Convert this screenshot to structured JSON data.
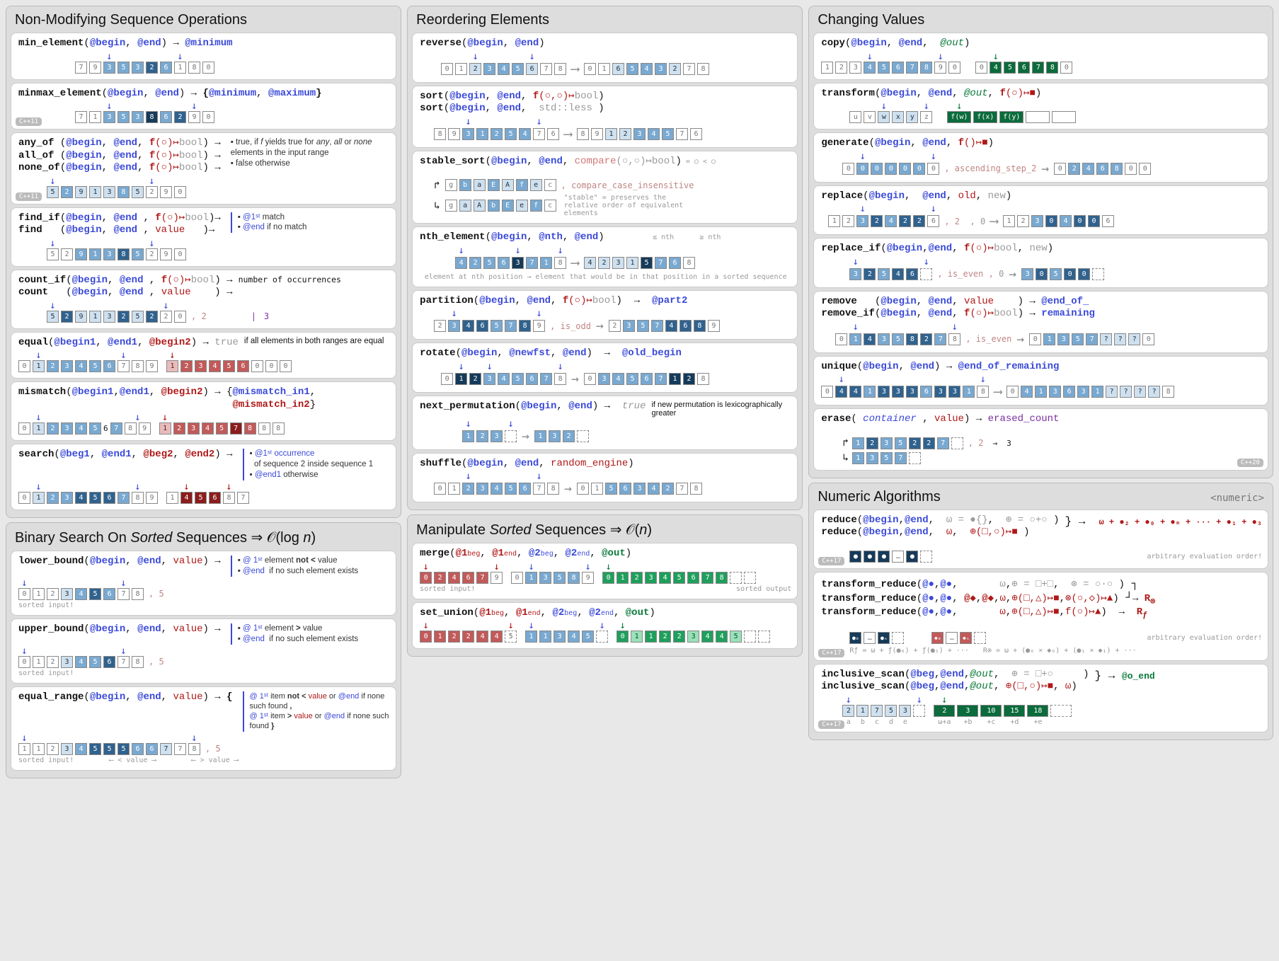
{
  "sections": {
    "nonmod": {
      "title": "Non-Modifying Sequence Operations"
    },
    "binsearch": {
      "title_html": "Binary Search On <i>Sorted</i> Sequences ⇒ 𝒪(log n)"
    },
    "reorder": {
      "title": "Reordering Elements"
    },
    "manip": {
      "title_html": "Manipulate <i>Sorted</i> Sequences ⇒ 𝒪(n)"
    },
    "change": {
      "title": "Changing Values"
    },
    "numeric": {
      "title": "Numeric Algorithms",
      "meta": "<numeric>"
    }
  },
  "min_element": {
    "fn": "min_element",
    "p1": "@begin",
    "p2": "@end",
    "ret": "@minimum",
    "cells": [
      7,
      9,
      3,
      5,
      3,
      2,
      6,
      1,
      8,
      0
    ]
  },
  "minmax_element": {
    "fn": "minmax_element",
    "p1": "@begin",
    "p2": "@end",
    "ret": "{@minimum, @maximum}",
    "cells": [
      7,
      1,
      3,
      5,
      3,
      8,
      6,
      2,
      9,
      0
    ],
    "tag": "C++11"
  },
  "any_all_none": {
    "f1": "any_of",
    "f2": "all_of",
    "f3": "none_of",
    "p1": "@begin",
    "p2": "@end",
    "pred": "f(○)↦bool",
    "n1": "true, if <i>f</i> yields true for <i>any</i>, <i>all</i> or <i>none</i> elements in the input range",
    "n2": "false otherwise",
    "cells": [
      5,
      2,
      9,
      1,
      3,
      8,
      5,
      2,
      9,
      0
    ],
    "tag": "C++11"
  },
  "find": {
    "f1": "find_if",
    "f2": "find",
    "p1": "@begin",
    "p2": "@end",
    "pred": "f(○)↦bool",
    "val": "value",
    "n1": "@1ˢᵗ match",
    "n2": "@end if no match",
    "cells": [
      5,
      2,
      9,
      1,
      3,
      8,
      5,
      2,
      9,
      0
    ],
    "value_ex": "8"
  },
  "count": {
    "f1": "count_if",
    "f2": "count",
    "p1": "@begin",
    "p2": "@end",
    "pred": "f(○)↦bool",
    "val": "value",
    "ret": "number of occurrences",
    "cells": [
      5,
      2,
      9,
      1,
      3,
      2,
      5,
      2,
      2,
      0
    ],
    "value_ex": "2",
    "out": "3"
  },
  "equal": {
    "fn": "equal",
    "p1": "@begin1",
    "p2": "@end1",
    "p3": "@begin2",
    "ret": "true",
    "note": "if all elements in both ranges are equal",
    "a": [
      0,
      1,
      2,
      3,
      4,
      5,
      6,
      7,
      8,
      9
    ],
    "b": [
      1,
      2,
      3,
      4,
      5,
      6,
      0,
      0,
      0
    ]
  },
  "mismatch": {
    "fn": "mismatch",
    "p1": "@begin1",
    "p2": "@end1",
    "p3": "@begin2",
    "ret": "{@mismatch_in1, @mismatch_in2}",
    "a": [
      0,
      1,
      2,
      3,
      4,
      5,
      6,
      7,
      8,
      9
    ],
    "b": [
      1,
      2,
      3,
      4,
      5,
      7,
      8,
      8,
      8
    ]
  },
  "search": {
    "fn": "search",
    "p1": "@beg1",
    "p2": "@end1",
    "p3": "@beg2",
    "p4": "@end2",
    "n1": "@1ˢᵗ occurrence",
    "n1b": "of sequence 2 inside sequence 1",
    "n2": "@end1 otherwise",
    "a": [
      0,
      1,
      2,
      3,
      4,
      5,
      6,
      7,
      8,
      9
    ],
    "b": [
      1,
      4,
      5,
      6,
      8,
      7
    ]
  },
  "lower_bound": {
    "fn": "lower_bound",
    "p1": "@begin",
    "p2": "@end",
    "val": "value",
    "n1": "@ 1ˢᵗ element <b>not &lt;</b> value",
    "n2": "@end  if no such element exists",
    "cells": [
      0,
      1,
      2,
      3,
      4,
      5,
      6,
      7,
      8
    ],
    "value_ex": "5",
    "sorted": "sorted input!"
  },
  "upper_bound": {
    "fn": "upper_bound",
    "p1": "@begin",
    "p2": "@end",
    "val": "value",
    "n1": "@ 1ˢᵗ element <b>&gt;</b> value",
    "n2": "@end  if no such element exists",
    "cells": [
      0,
      1,
      2,
      3,
      4,
      5,
      6,
      7,
      8
    ],
    "value_ex": "5",
    "sorted": "sorted input!"
  },
  "equal_range": {
    "fn": "equal_range",
    "p1": "@begin",
    "p2": "@end",
    "val": "value",
    "n1": "@ 1ˢᵗ item <b>not &lt;</b> value or @end if none such found <b>,</b>",
    "n2": "@ 1ˢᵗ item <b>&gt;</b> value or @end if none such found <b>}</b>",
    "cells": [
      1,
      1,
      2,
      3,
      4,
      5,
      5,
      5,
      6,
      6,
      7,
      7,
      8
    ],
    "value_ex": "5",
    "sorted": "sorted input!",
    "lt": "< value",
    "gt": "> value"
  },
  "reverse": {
    "fn": "reverse",
    "p1": "@begin",
    "p2": "@end",
    "a": [
      0,
      1,
      2,
      3,
      4,
      5,
      6,
      7,
      8
    ],
    "b": [
      0,
      1,
      6,
      5,
      4,
      3,
      2,
      7,
      8
    ]
  },
  "sort": {
    "fn": "sort",
    "p1": "@begin",
    "p2": "@end",
    "pred": "f(○,○)↦bool",
    "alt": "std::less",
    "a": [
      8,
      9,
      3,
      1,
      2,
      5,
      4,
      7,
      6
    ],
    "b": [
      8,
      9,
      1,
      2,
      3,
      4,
      5,
      7,
      6
    ]
  },
  "stable_sort": {
    "fn": "stable_sort",
    "p1": "@begin",
    "p2": "@end",
    "pred": "compare(○,○)↦bool",
    "a": [
      "g",
      "b",
      "a",
      "E",
      "A",
      "f",
      "e",
      "c"
    ],
    "b": [
      "g",
      "a",
      "A",
      "b",
      "E",
      "e",
      "f",
      "c"
    ],
    "ex": "compare_case_insensitive",
    "note": "\"stable\" = preserves the relative order of equivalent elements",
    "hint": "= ○ < ○"
  },
  "nth_element": {
    "fn": "nth_element",
    "p1": "@begin",
    "p2": "@nth",
    "p3": "@end",
    "a": [
      4,
      2,
      5,
      6,
      3,
      7,
      1,
      8
    ],
    "b": [
      4,
      2,
      3,
      1,
      5,
      7,
      6,
      8
    ],
    "note": "element at nth position → element that would be in that position in a sorted sequence",
    "l": "≤ nth",
    "r": "≥ nth"
  },
  "partition": {
    "fn": "partition",
    "p1": "@begin",
    "p2": "@end",
    "pred": "f(○)↦bool",
    "ret": "@part2",
    "a": [
      2,
      3,
      4,
      6,
      5,
      7,
      8,
      9
    ],
    "b": [
      2,
      3,
      5,
      7,
      4,
      6,
      8,
      9
    ],
    "ex": "is_odd"
  },
  "rotate": {
    "fn": "rotate",
    "p1": "@begin",
    "p2": "@newfst",
    "p3": "@end",
    "ret": "@old_begin",
    "a": [
      0,
      1,
      2,
      3,
      4,
      5,
      6,
      7,
      8
    ],
    "b": [
      0,
      3,
      4,
      5,
      6,
      7,
      1,
      2,
      8
    ]
  },
  "next_perm": {
    "fn": "next_permutation",
    "p1": "@begin",
    "p2": "@end",
    "ret": "true",
    "note": "if new permutation is lexicographically greater",
    "a": [
      1,
      2,
      3
    ],
    "b": [
      1,
      3,
      2
    ]
  },
  "shuffle": {
    "fn": "shuffle",
    "p1": "@begin",
    "p2": "@end",
    "p3": "random_engine",
    "a": [
      0,
      1,
      2,
      3,
      4,
      5,
      6,
      7,
      8
    ],
    "b": [
      0,
      1,
      5,
      6,
      3,
      4,
      2,
      7,
      8
    ]
  },
  "merge": {
    "fn": "merge",
    "p1": "@1_beg",
    "p2": "@1_end",
    "p3": "@2_beg",
    "p4": "@2_end",
    "p5": "@out",
    "a": [
      0,
      2,
      4,
      6,
      7,
      9
    ],
    "b": [
      0,
      1,
      3,
      5,
      8,
      9
    ],
    "c": [
      0,
      1,
      2,
      3,
      4,
      5,
      6,
      7,
      8,
      " ",
      " "
    ],
    "sorted": "sorted input!",
    "sortedout": "sorted output"
  },
  "set_union": {
    "fn": "set_union",
    "p1": "@1_beg",
    "p2": "@1_end",
    "p3": "@2_beg",
    "p4": "@2_end",
    "p5": "@out",
    "a": [
      0,
      1,
      2,
      2,
      4,
      4,
      5
    ],
    "b": [
      1,
      1,
      3,
      4,
      5
    ],
    "c": [
      0,
      1,
      1,
      2,
      2,
      3,
      4,
      4,
      5,
      " ",
      " "
    ]
  },
  "copy": {
    "fn": "copy",
    "p1": "@begin",
    "p2": "@end",
    "p3": "@out",
    "a": [
      1,
      2,
      3,
      4,
      5,
      6,
      7,
      8,
      9,
      0
    ],
    "b": [
      0,
      4,
      5,
      6,
      7,
      8,
      0
    ]
  },
  "transform": {
    "fn": "transform",
    "p1": "@begin",
    "p2": "@end",
    "p3": "@out",
    "pred": "f(○)↦■",
    "a": [
      "u",
      "v",
      "w",
      "x",
      "y",
      "z"
    ],
    "b": [
      "f(w)",
      "f(x)",
      "f(y)",
      " ",
      " ",
      " "
    ]
  },
  "generate": {
    "fn": "generate",
    "p1": "@begin",
    "p2": "@end",
    "pred": "f()↦■",
    "a": [
      0,
      0,
      0,
      0,
      0,
      0,
      0
    ],
    "b": [
      0,
      2,
      4,
      6,
      8,
      0,
      0
    ],
    "ex": "ascending_step_2"
  },
  "replace": {
    "fn": "replace",
    "p1": "@begin",
    "p2": "@end",
    "old": "old",
    "new": "new",
    "a": [
      1,
      2,
      3,
      2,
      4,
      2,
      2,
      6
    ],
    "oldv": "2",
    "newv": "0",
    "b": [
      1,
      2,
      3,
      0,
      4,
      0,
      0,
      6
    ]
  },
  "replace_if": {
    "fn": "replace_if",
    "p1": "@begin",
    "p2": "@end",
    "pred": "f(○)↦bool",
    "new": "new",
    "a": [
      3,
      2,
      5,
      4,
      6
    ],
    "ex": "is_even",
    "newv": "0",
    "b": [
      3,
      0,
      5,
      0,
      0
    ]
  },
  "remove": {
    "f1": "remove",
    "f2": "remove_if",
    "p1": "@begin",
    "p2": "@end",
    "val": "value",
    "pred": "f(○)↦bool",
    "ret": "@end_of_",
    "ret2": "remaining",
    "a": [
      0,
      1,
      4,
      3,
      5,
      8,
      2,
      7,
      8
    ],
    "ex": "is_even",
    "b": [
      0,
      1,
      3,
      5,
      7,
      "?",
      "?",
      "?",
      0
    ]
  },
  "unique": {
    "fn": "unique",
    "p1": "@begin",
    "p2": "@end",
    "ret": "@end_of_remaining",
    "a": [
      0,
      4,
      4,
      1,
      3,
      3,
      3,
      6,
      3,
      3,
      1,
      8
    ],
    "b": [
      0,
      4,
      1,
      3,
      6,
      3,
      1,
      "?",
      "?",
      "?",
      "?",
      8
    ]
  },
  "erase": {
    "fn": "erase",
    "p1": "container",
    "val": "value",
    "ret": "erased_count",
    "a": [
      1,
      2,
      3,
      5,
      2,
      2,
      7
    ],
    "valv": "2",
    "out": "3",
    "b": [
      1,
      3,
      5,
      7
    ],
    "tag": "C++20"
  },
  "reduce": {
    "fn": "reduce",
    "p1": "@begin",
    "p2": "@end",
    "w": "ω",
    "wdef": "= ●{}",
    "op": "⊕(□,○)↦■",
    "opdef": "= ○+○",
    "ret": "ω + ●₂ + ●₀ + ●ₙ + ··· + ●₁ + ●₃",
    "tag": "C++17",
    "note": "arbitrary evaluation order!",
    "cells": [
      "●",
      "●",
      "●",
      "…",
      "●"
    ]
  },
  "transform_reduce": {
    "fn": "transform_reduce",
    "line1_p": "@●",
    "line1_q": "@●",
    "line2_p": "@●",
    "line2_q": "@●",
    "line2_r": "@◆",
    "line2_s": "@◆",
    "line3_p": "@●",
    "line3_q": "@●",
    "w": "ω",
    "op1": "⊕",
    "opdef1": "= □+□",
    "op2": "⊗",
    "opdef2": "= ○·○",
    "op3": "⊕(□,△)↦■",
    "op4": "⊗(○,◇)↦▲",
    "opf": "⊕(□,△)↦■",
    "f": "f(○)↦▲",
    "ret1": "R⊗",
    "ret2": "Rƒ",
    "tag": "C++17",
    "note": "arbitrary evaluation order!",
    "eq1": "Rƒ = ω + ƒ(●₀) + ƒ(●₁) + ···",
    "eq2": "R⊗ = ω + (●₀ × ◆₀) + (●₁ × ◆₁) + ···"
  },
  "scan": {
    "f1": "inclusive_scan",
    "f2": "inclusive_scan",
    "p1": "@beg",
    "p2": "@end",
    "p3": "@out",
    "op": "⊕",
    "opdef": "= □+○",
    "op2": "⊕(□,○)↦■",
    "w": "ω",
    "ret": "@o_end",
    "a": [
      "a",
      "b",
      "c",
      "d",
      "e"
    ],
    "av": [
      2,
      1,
      7,
      5,
      3
    ],
    "b": [
      2,
      3,
      10,
      15,
      18
    ],
    "sub": [
      "ω+a",
      "  +b",
      "  +c",
      "  +d",
      "  +e"
    ],
    "tag": "C++17"
  }
}
